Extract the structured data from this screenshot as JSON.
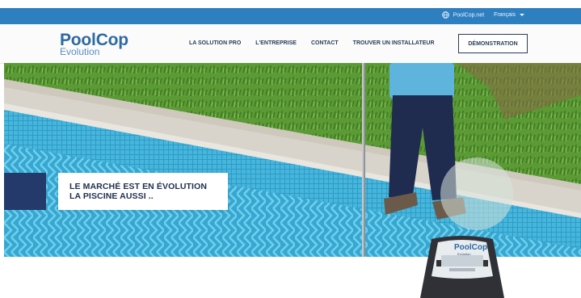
{
  "topbar": {
    "brand_link": "PoolCop.net",
    "language": "Français"
  },
  "header": {
    "logo_title": "PoolCop",
    "logo_subtitle": "Evolution",
    "nav": [
      {
        "label": "LA SOLUTION PRO"
      },
      {
        "label": "L'ENTREPRISE"
      },
      {
        "label": "CONTACT"
      },
      {
        "label": "TROUVER UN INSTALLATEUR"
      }
    ],
    "cta": "DÉMONSTRATION"
  },
  "hero": {
    "headline_line1": "LE MARCHÉ EST EN ÉVOLUTION",
    "headline_line2": "LA PISCINE AUSSI ..",
    "accent_color": "#243a6b"
  },
  "device": {
    "brand": "PoolCop",
    "model": "Evolution"
  },
  "colors": {
    "topbar": "#2d7fc0",
    "brand": "#2d6aa3",
    "nav_text": "#2a3c57"
  }
}
